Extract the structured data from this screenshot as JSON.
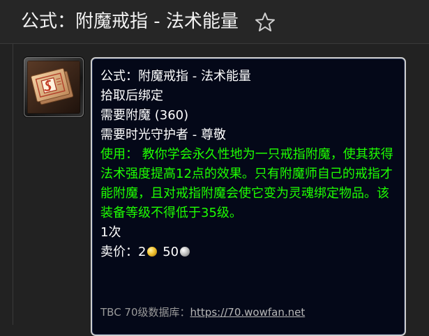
{
  "header": {
    "title": "公式：附魔戒指 - 法术能量",
    "favorite_icon": "star-outline-icon"
  },
  "item": {
    "icon": "enchanting-formula-scroll-icon",
    "name": "公式：附魔戒指 - 法术能量",
    "binding": "拾取后绑定",
    "requires_skill": "需要附魔 (360)",
    "requires_reputation": "需要时光守护者 - 尊敬",
    "use_text": "使用： 教你学会永久性地为一只戒指附魔，使其获得法术强度提高12点的效果。只有附魔师自己的戒指才能附魔，且对戒指附魔会使它变为灵魂绑定物品。该装备等级不得低于35级。",
    "charges": "1次",
    "sell_label": "卖价：",
    "sell_gold": "2",
    "sell_silver": "50",
    "colors": {
      "use_text": "#1eff00",
      "tooltip_background": "#040818",
      "tooltip_border": "#cfcfcf"
    }
  },
  "footer": {
    "source_label": "TBC 70级数据库：",
    "source_link": "https://70.wowfan.net"
  }
}
